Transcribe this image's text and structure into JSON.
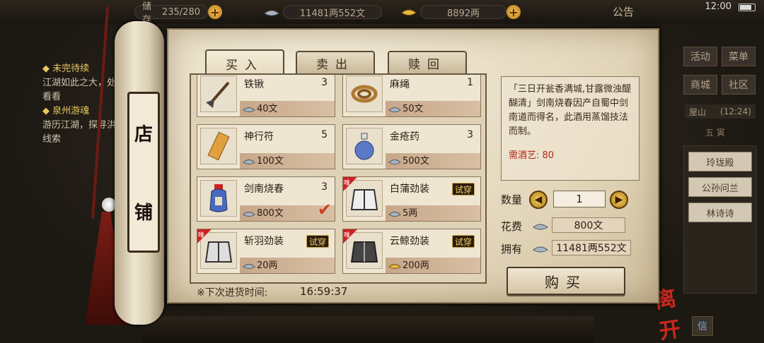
{
  "topbar": {
    "capacity_label": "储存",
    "capacity_value": "235/280",
    "money": "11481两552文",
    "gold": "8892两",
    "announcement": "公告",
    "time": "12:00"
  },
  "quests": [
    {
      "title": "未完待续",
      "desc": "江湖如此之大，处去看看"
    },
    {
      "title": "泉州游魂",
      "desc": "游历江湖，探寻洪的线索"
    }
  ],
  "right_menu": {
    "buttons": [
      "活动",
      "菜单",
      "商城",
      "社区"
    ],
    "location": "屋山",
    "location_time": "(12:24)",
    "sub_label": "五 寅"
  },
  "npcs": [
    "玲珑殿",
    "公孙问兰",
    "林诗诗"
  ],
  "leave_label": "离开",
  "message_label": "信",
  "scroll": {
    "line1": "店",
    "line2": "铺"
  },
  "tabs": [
    "买入",
    "卖出",
    "赎回"
  ],
  "items": [
    {
      "name": "铁锹",
      "qty": "3",
      "price": "40文",
      "currency": "silver",
      "try": ""
    },
    {
      "name": "麻绳",
      "qty": "1",
      "price": "50文",
      "currency": "silver",
      "try": ""
    },
    {
      "name": "神行符",
      "qty": "5",
      "price": "100文",
      "currency": "silver",
      "try": ""
    },
    {
      "name": "金疮药",
      "qty": "3",
      "price": "500文",
      "currency": "silver",
      "try": ""
    },
    {
      "name": "剑南烧春",
      "qty": "3",
      "price": "800文",
      "currency": "silver",
      "try": ""
    },
    {
      "name": "白蒲劲装",
      "qty": "",
      "price": "5两",
      "currency": "silver",
      "try": "试穿"
    },
    {
      "name": "斩羽劲装",
      "qty": "",
      "price": "20两",
      "currency": "silver",
      "try": "试穿"
    },
    {
      "name": "云鲸劲装",
      "qty": "",
      "price": "200两",
      "currency": "gold",
      "try": "试穿"
    }
  ],
  "only_tag": "唯",
  "restock": {
    "label": "※下次进货时间:",
    "time": "16:59:37"
  },
  "detail": {
    "description": "「三日开瓮香满城,甘露微浊醍醐清」剑南烧春因产自蜀中剑南道而得名，此酒用蒸馏技法而制。",
    "requirement": "需酒艺: 80",
    "qty_label": "数量",
    "qty_value": "1",
    "cost_label": "花费",
    "cost_value": "800文",
    "own_label": "拥有",
    "own_value": "11481两552文",
    "buy_label": "购买"
  },
  "colors": {
    "parchment": "#e9dfc8",
    "ink": "#2b1d14",
    "accent_red": "#b2281c",
    "gold": "#f4d064"
  }
}
